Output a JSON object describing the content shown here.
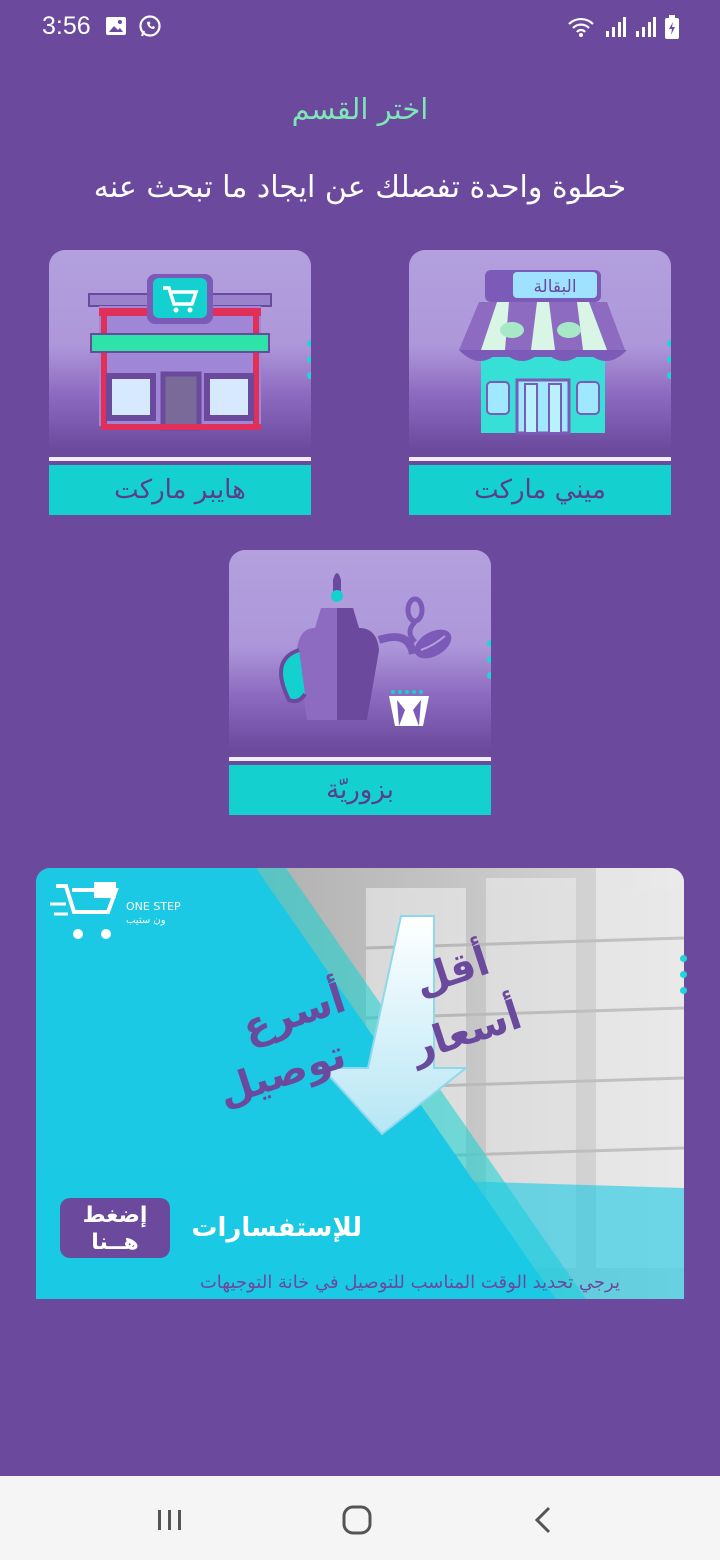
{
  "status_bar": {
    "time": "3:56",
    "left_icons": [
      "image-icon",
      "whatsapp-icon"
    ],
    "right_icons": [
      "wifi-icon",
      "signal-icon",
      "signal-icon-2",
      "battery-icon"
    ]
  },
  "header": {
    "title": "اختر القسم",
    "subtitle": "خطوة واحدة تفصلك عن ايجاد ما تبحث عنه"
  },
  "categories": [
    {
      "label": "ميني ماركت",
      "icon": "mini-market-store-icon",
      "sign": "البقالة"
    },
    {
      "label": "هايبر ماركت",
      "icon": "hypermarket-cart-store-icon"
    },
    {
      "label": "بزوريّة",
      "icon": "dallah-coffee-pot-nuts-icon"
    }
  ],
  "banner": {
    "logo_text": "ONE STEP",
    "logo_sub": "ون ستيب",
    "headline_1": "أسرع",
    "headline_2": "توصيل",
    "headline_3": "أقل",
    "headline_4": "أسعار",
    "inquiries": "للإستفسارات",
    "button_line1": "إضغط",
    "button_line2": "هــنا",
    "footnote": "يرجي تحديد الوقت المناسب للتوصيل في خانة التوجيهات"
  },
  "colors": {
    "background": "#6b4a9e",
    "accent_teal": "#14d1cf",
    "title_green": "#7fe6b8",
    "card_purple": "#b3a0dd"
  },
  "nav_bar": {
    "buttons": [
      "recent-apps-icon",
      "home-icon",
      "back-icon"
    ]
  }
}
